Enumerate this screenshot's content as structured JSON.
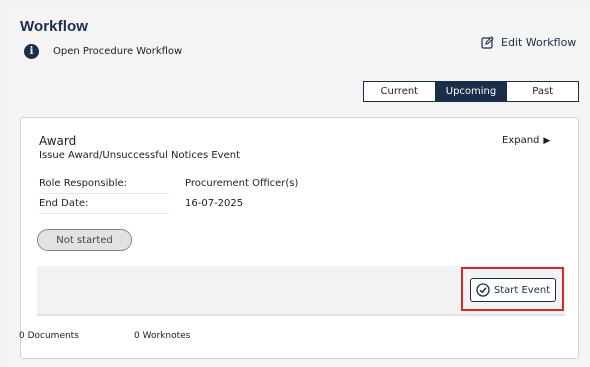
{
  "header": {
    "title": "Workflow",
    "info_link": "Open Procedure Workflow",
    "edit_label": "Edit Workflow"
  },
  "tabs": [
    {
      "label": "Current",
      "active": false
    },
    {
      "label": "Upcoming",
      "active": true
    },
    {
      "label": "Past",
      "active": false
    }
  ],
  "event": {
    "title": "Award",
    "subtitle": "Issue Award/Unsuccessful Notices Event",
    "expand_label": "Expand",
    "role_label": "Role Responsible:",
    "role_value": "Procurement Officer(s)",
    "end_label": "End Date:",
    "end_value": "16-07-2025",
    "status": "Not started",
    "start_label": "Start Event",
    "documents": "0 Documents",
    "worknotes": "0 Worknotes"
  },
  "colors": {
    "accent": "#1a2e4a",
    "highlight": "#d32b2b",
    "background": "#f2f2f2"
  },
  "icons": {
    "info": "info-circle-icon",
    "edit": "pencil-square-icon",
    "expand": "triangle-right-icon",
    "start": "check-circle-icon"
  }
}
